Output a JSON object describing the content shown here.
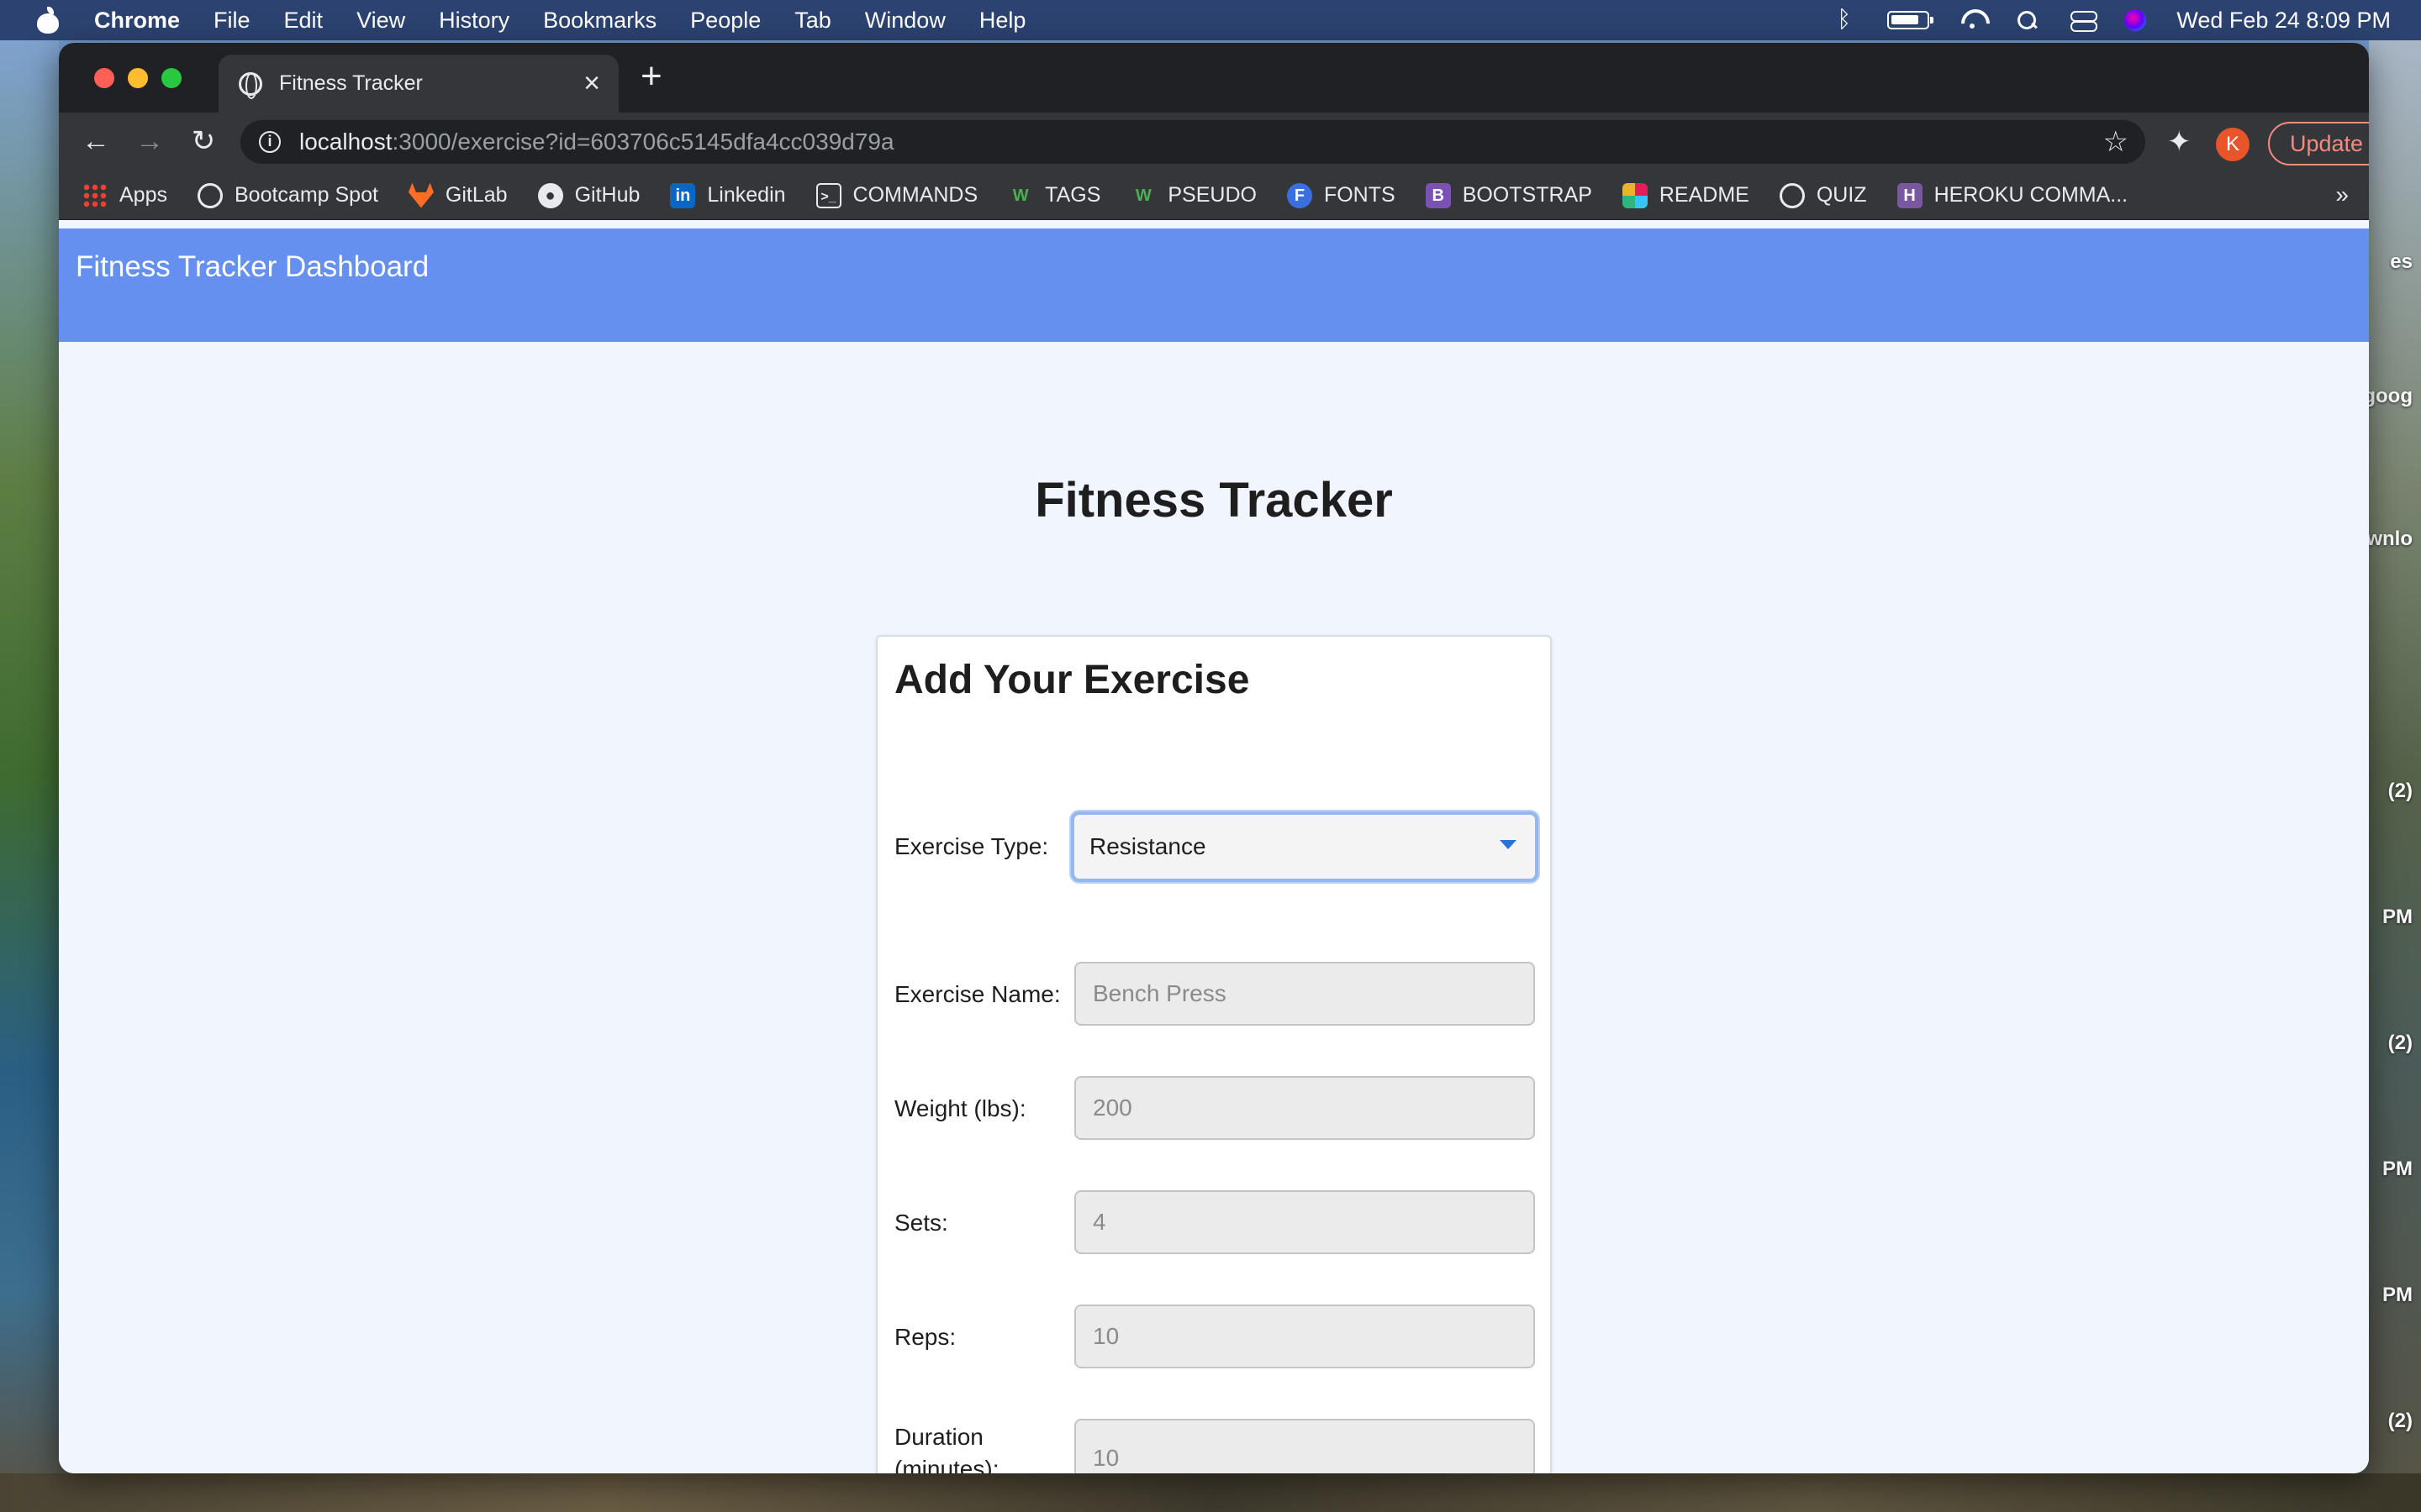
{
  "menubar": {
    "app_name": "Chrome",
    "items": [
      "File",
      "Edit",
      "View",
      "History",
      "Bookmarks",
      "People",
      "Tab",
      "Window",
      "Help"
    ],
    "clock": "Wed Feb 24  8:09 PM"
  },
  "browser": {
    "tab_title": "Fitness Tracker",
    "url_host": "localhost",
    "url_rest": ":3000/exercise?id=603706c5145dfa4cc039d79a",
    "avatar_letter": "K",
    "update_label": "Update",
    "bookmarks": [
      {
        "label": "Apps",
        "icon": "apps-grid-icon"
      },
      {
        "label": "Bootcamp Spot",
        "icon": "globe-icon"
      },
      {
        "label": "GitLab",
        "icon": "gitlab-icon"
      },
      {
        "label": "GitHub",
        "icon": "github-icon"
      },
      {
        "label": "Linkedin",
        "icon": "linkedin-icon"
      },
      {
        "label": "COMMANDS",
        "icon": "terminal-icon"
      },
      {
        "label": "TAGS",
        "icon": "w3-icon"
      },
      {
        "label": "PSEUDO",
        "icon": "w3-icon"
      },
      {
        "label": "FONTS",
        "icon": "fonts-icon"
      },
      {
        "label": "BOOTSTRAP",
        "icon": "bootstrap-icon"
      },
      {
        "label": "README",
        "icon": "slack-icon"
      },
      {
        "label": "QUIZ",
        "icon": "globe-icon"
      },
      {
        "label": "HEROKU COMMA...",
        "icon": "heroku-icon"
      }
    ]
  },
  "desktop": {
    "edge_labels": [
      "es",
      "goog",
      "wnlo",
      "(2)",
      "PM",
      "(2)",
      "PM",
      "PM",
      "(2)"
    ]
  },
  "page": {
    "nav_brand": "Fitness Tracker Dashboard",
    "title": "Fitness Tracker",
    "card_title": "Add Your Exercise",
    "colors": {
      "header": "#6590f0",
      "background": "#f1f6fe",
      "select_focus": "#93b7ee"
    },
    "form": {
      "exercise_type": {
        "label": "Exercise Type:",
        "value": "Resistance"
      },
      "exercise_name": {
        "label": "Exercise Name:",
        "placeholder": "Bench Press"
      },
      "weight": {
        "label": "Weight (lbs):",
        "placeholder": "200"
      },
      "sets": {
        "label": "Sets:",
        "placeholder": "4"
      },
      "reps": {
        "label": "Reps:",
        "placeholder": "10"
      },
      "duration": {
        "label_line1": "Duration",
        "label_line2": "(minutes):",
        "placeholder": "10"
      }
    }
  }
}
